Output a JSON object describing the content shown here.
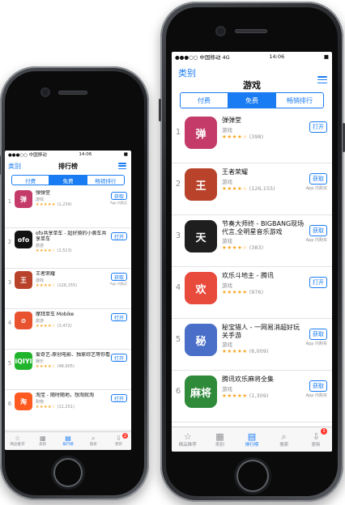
{
  "left_phone": {
    "status": {
      "carrier": "●●●○○ 中国移动",
      "time": "14:06",
      "battery": "■"
    },
    "nav": {
      "back": "类别",
      "title": "排行榜"
    },
    "segments": [
      "付费",
      "免费",
      "畅销排行"
    ],
    "apps": [
      {
        "rank": "1",
        "name": "弹弹堂",
        "category": "游戏",
        "stars": "★★★★★",
        "ratings": "(1,234)",
        "button": "获取",
        "iap": "App 内购买",
        "icon_color": "#c43b6a",
        "icon_glyph": "弹"
      },
      {
        "rank": "2",
        "name": "ofo共享单车 - 超好骑的小黄车共享单车",
        "category": "旅游",
        "stars": "★★★★☆",
        "ratings": "(1,513)",
        "button": "打开",
        "iap": "",
        "icon_color": "#111111",
        "icon_glyph": "ofo"
      },
      {
        "rank": "3",
        "name": "王者荣耀",
        "category": "游戏",
        "stars": "★★★★☆",
        "ratings": "(126,155)",
        "button": "获取",
        "iap": "App 内购买",
        "icon_color": "#b8432a",
        "icon_glyph": "王"
      },
      {
        "rank": "4",
        "name": "摩拜单车 Mobike",
        "category": "旅游",
        "stars": "★★★★☆",
        "ratings": "(3,472)",
        "button": "打开",
        "iap": "",
        "icon_color": "#e8522e",
        "icon_glyph": "⊘"
      },
      {
        "rank": "5",
        "name": "爱奇艺-原创电影、独家综艺等你看",
        "category": "娱乐",
        "stars": "★★★★☆",
        "ratings": "(48,905)",
        "button": "打开",
        "iap": "",
        "icon_color": "#1fb42b",
        "icon_glyph": "iQIYI"
      },
      {
        "rank": "6",
        "name": "淘宝 - 随时随地，想淘就淘",
        "category": "购物",
        "stars": "★★★★☆",
        "ratings": "(11,251)",
        "button": "打开",
        "iap": "",
        "icon_color": "#ff5a1f",
        "icon_glyph": "淘"
      }
    ],
    "tabs": [
      {
        "label": "精品推荐",
        "icon": "☆"
      },
      {
        "label": "类别",
        "icon": "▦"
      },
      {
        "label": "排行榜",
        "icon": "▤"
      },
      {
        "label": "搜索",
        "icon": "⌕"
      },
      {
        "label": "更新",
        "icon": "⇩",
        "badge": "2"
      }
    ]
  },
  "right_phone": {
    "status": {
      "carrier": "●●●○○ 中国移动 4G",
      "time": "14:06",
      "battery": "■"
    },
    "nav": {
      "back": "类别",
      "title": "游戏"
    },
    "segments": [
      "付费",
      "免费",
      "畅销排行"
    ],
    "apps": [
      {
        "rank": "1",
        "name": "弹弹堂",
        "category": "游戏",
        "stars": "★★★★☆",
        "ratings": "(398)",
        "button": "打开",
        "iap": "",
        "icon_color": "#c43b6a",
        "icon_glyph": "弹"
      },
      {
        "rank": "2",
        "name": "王者荣耀",
        "category": "游戏",
        "stars": "★★★★☆",
        "ratings": "(126,155)",
        "button": "获取",
        "iap": "App 内购买",
        "icon_color": "#b8432a",
        "icon_glyph": "王"
      },
      {
        "rank": "3",
        "name": "节奏大师终 - BIGBANG现场代言,全明星音乐游戏",
        "category": "游戏",
        "stars": "★★★★☆",
        "ratings": "(383)",
        "button": "获取",
        "iap": "App 内购买",
        "icon_color": "#1e1e1e",
        "icon_glyph": "天"
      },
      {
        "rank": "4",
        "name": "欢乐斗地主 - 腾讯",
        "category": "游戏",
        "stars": "★★★★★",
        "ratings": "(976)",
        "button": "打开",
        "iap": "",
        "icon_color": "#e84a3c",
        "icon_glyph": "欢"
      },
      {
        "rank": "5",
        "name": "秘宝猎人 - 一网易消超好玩关手游",
        "category": "游戏",
        "stars": "★★★★★",
        "ratings": "(6,009)",
        "button": "获取",
        "iap": "App 内购买",
        "icon_color": "#4a6fc9",
        "icon_glyph": "秘"
      },
      {
        "rank": "6",
        "name": "腾讯欢乐麻将全集",
        "category": "游戏",
        "stars": "★★★★★",
        "ratings": "(1,309)",
        "button": "获取",
        "iap": "App 内购买",
        "icon_color": "#2f8a3a",
        "icon_glyph": "麻将"
      }
    ],
    "tabs": [
      {
        "label": "精品推荐",
        "icon": "☆"
      },
      {
        "label": "类别",
        "icon": "▦"
      },
      {
        "label": "排行榜",
        "icon": "▤"
      },
      {
        "label": "搜索",
        "icon": "⌕"
      },
      {
        "label": "更新",
        "icon": "⇩",
        "badge": "3"
      }
    ]
  },
  "colors": {
    "accent": "#1a7cf2",
    "star": "#f5a623",
    "badge": "#ff3b30"
  }
}
